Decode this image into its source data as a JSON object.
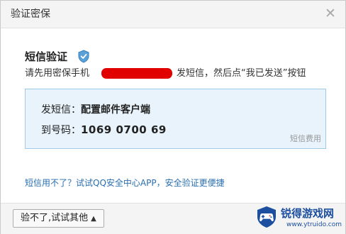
{
  "dialog": {
    "title": "验证密保",
    "close_icon": "close-icon"
  },
  "sms": {
    "section_title": "短信验证",
    "shield_icon": "shield-check-icon",
    "instruction_prefix": "请先用密保手机",
    "instruction_suffix": "发短信，然后点“我已发送”按钮",
    "content_label": "发短信：",
    "content_value": "配置邮件客户端",
    "number_label": "到号码：",
    "number_value": "1069 0700 69",
    "fee_note": "短信费用"
  },
  "alternative": {
    "link_text": "短信用不了？试试QQ安全中心APP，安全验证更便捷"
  },
  "footer": {
    "fallback_button": "验不了,试试其他",
    "caret_icon": "caret-up-icon"
  },
  "watermark": {
    "name": "锐得游戏网",
    "url": "www.ytruido.com"
  },
  "colors": {
    "accent_blue": "#2a6fb0",
    "info_box_bg": "#e8f3fb",
    "info_box_border": "#9fcbe6",
    "redaction": "#e00000"
  }
}
